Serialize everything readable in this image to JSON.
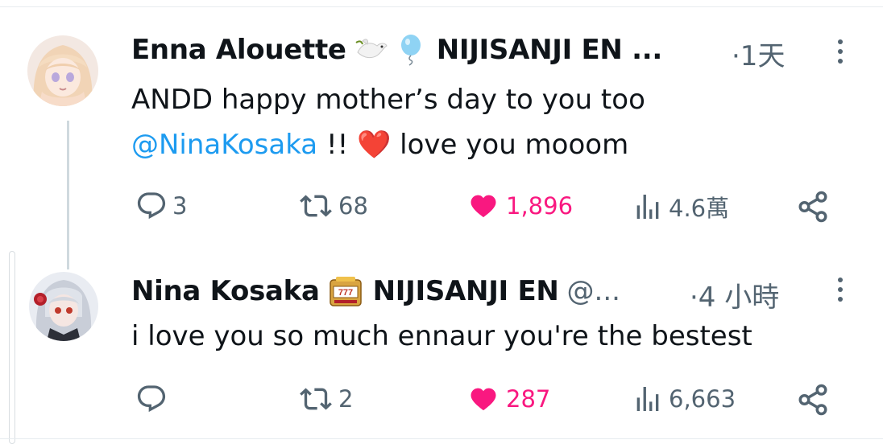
{
  "tweets": [
    {
      "author": "Enna Alouette",
      "badges": [
        "dove-emoji",
        "balloon-emoji"
      ],
      "org": "NIJISANJI EN ...",
      "time": "·1天",
      "text_line1": "ANDD happy mother’s day to you too",
      "mention": "@NinaKosaka",
      "text_line2_rest": " !! ",
      "heart_emoji": "❤️",
      "text_line2_end": " love you mooom",
      "replies": "3",
      "retweets": "68",
      "likes": "1,896",
      "views": "4.6萬",
      "liked": true
    },
    {
      "author": "Nina Kosaka",
      "badges": [
        "slot-machine-emoji"
      ],
      "org": "NIJISANJI EN",
      "handle": "@...",
      "time": "·4 小時",
      "text": "i love you so much ennaur you're the bestest",
      "replies": "",
      "retweets": "2",
      "likes": "287",
      "views": "6,663",
      "liked": true
    }
  ],
  "colors": {
    "text": "#0f1419",
    "gray": "#536471",
    "link": "#1d9bf0",
    "like": "#f91880"
  }
}
